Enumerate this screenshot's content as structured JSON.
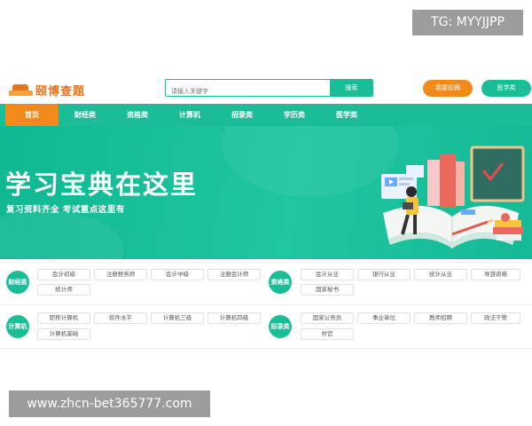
{
  "watermark": {
    "top": "TG: MYYJJPP",
    "bottom": "www.zhcn-bet365777.com"
  },
  "logo": {
    "text": "颐博查题"
  },
  "search": {
    "placeholder": "请输入关键字",
    "button": "搜索"
  },
  "header_buttons": {
    "join": "我要投稿",
    "medical": "医学类"
  },
  "nav": {
    "items": [
      "首页",
      "财经类",
      "资格类",
      "计算机",
      "招录类",
      "学历类",
      "医学类"
    ],
    "active_index": 0
  },
  "banner": {
    "title": "学习宝典在这里",
    "subtitle": "复习资料齐全 考试重点这里有"
  },
  "categories": {
    "caijing": {
      "badge": "财经类",
      "tags": [
        "会计初级",
        "注册税务师",
        "会计中级",
        "注册会计师",
        "统计师"
      ]
    },
    "zige": {
      "badge": "资格类",
      "tags": [
        "会计从业",
        "银行从业",
        "统计从业",
        "导游资格",
        "国家秘书"
      ]
    },
    "jisuanji": {
      "badge": "计算机",
      "tags": [
        "职称计算机",
        "软件水平",
        "计算机三级",
        "计算机四级",
        "计算机基础"
      ]
    },
    "zhaolu": {
      "badge": "招录类",
      "tags": [
        "国家公务员",
        "事业单位",
        "教师招聘",
        "政法干警",
        "村官"
      ]
    }
  },
  "colors": {
    "primary": "#1bbd97",
    "accent": "#f08a1a"
  }
}
